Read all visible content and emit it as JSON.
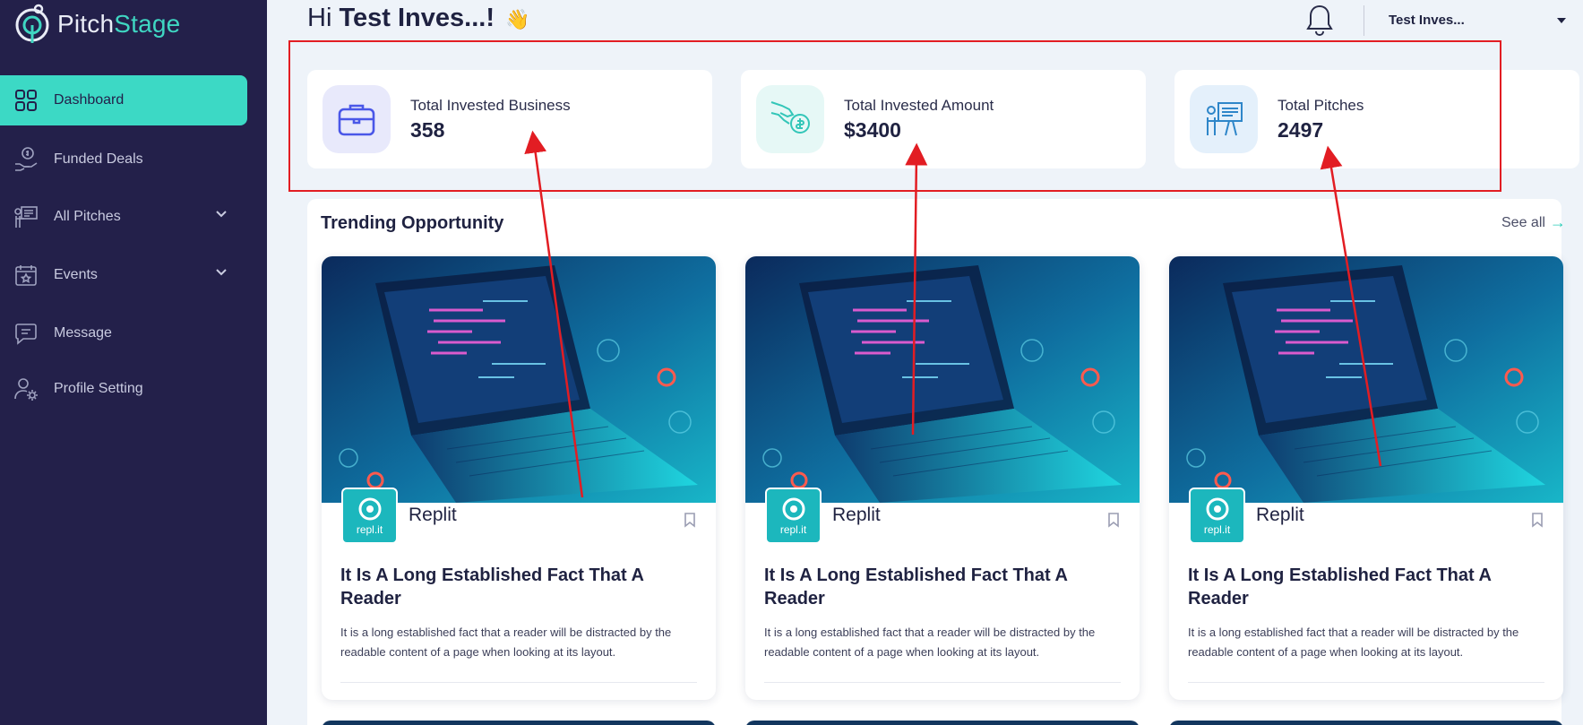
{
  "app": {
    "logo_prefix": "Pitch",
    "logo_suffix": "Stage"
  },
  "sidebar": {
    "items": [
      {
        "label": "Dashboard",
        "icon": "grid-icon"
      },
      {
        "label": "Funded Deals",
        "icon": "money-hand-icon"
      },
      {
        "label": "All Pitches",
        "icon": "presentation-icon"
      },
      {
        "label": "Events",
        "icon": "calendar-icon"
      },
      {
        "label": "Message",
        "icon": "message-icon"
      },
      {
        "label": "Profile Setting",
        "icon": "user-gear-icon"
      }
    ]
  },
  "header": {
    "greeting_prefix": "Hi",
    "greeting_name": "Test Inves...!",
    "greeting_emoji": "👋",
    "user_name": "Test Inves..."
  },
  "stats": [
    {
      "label": "Total Invested Business",
      "value": "358",
      "icon": "briefcase-icon"
    },
    {
      "label": "Total Invested Amount",
      "value": "$3400",
      "icon": "money-hand-icon"
    },
    {
      "label": "Total Pitches",
      "value": "2497",
      "icon": "presentation-icon"
    }
  ],
  "trending": {
    "title": "Trending Opportunity",
    "see_all": "See all",
    "cards": [
      {
        "company": "Replit",
        "logo_text": "repl.it",
        "title": "It Is A Long Established Fact That A Reader",
        "description": "It is a long established fact that a reader will be distracted by the readable content of a page when looking at its layout."
      },
      {
        "company": "Replit",
        "logo_text": "repl.it",
        "title": "It Is A Long Established Fact That A Reader",
        "description": "It is a long established fact that a reader will be distracted by the readable content of a page when looking at its layout."
      },
      {
        "company": "Replit",
        "logo_text": "repl.it",
        "title": "It Is A Long Established Fact That A Reader",
        "description": "It is a long established fact that a reader will be distracted by the readable content of a page when looking at its layout."
      }
    ]
  },
  "colors": {
    "sidebar_bg": "#23204a",
    "accent": "#3cd9c5",
    "annotation": "#e21d23"
  }
}
